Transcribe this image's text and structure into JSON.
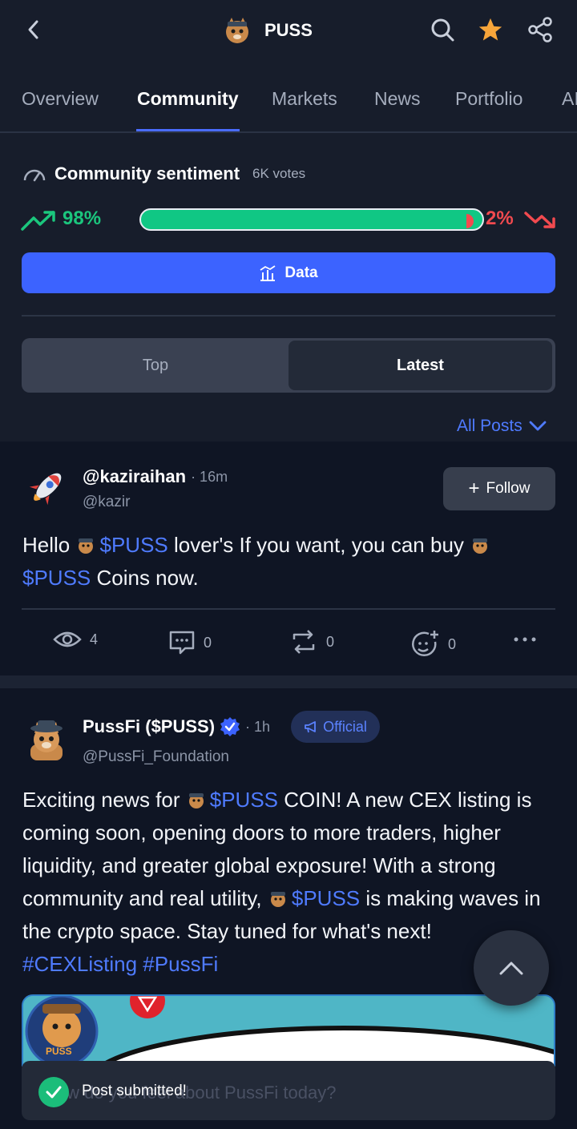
{
  "header": {
    "coin_name": "PUSS",
    "icons": [
      "back-chevron-icon",
      "search-icon",
      "star-icon",
      "share-icon"
    ],
    "star_color": "#f7a53a"
  },
  "tabs": [
    {
      "label": "Overview",
      "active": false
    },
    {
      "label": "Community",
      "active": true
    },
    {
      "label": "Markets",
      "active": false
    },
    {
      "label": "News",
      "active": false
    },
    {
      "label": "Portfolio",
      "active": false
    },
    {
      "label": "AI",
      "active": false
    }
  ],
  "sentiment": {
    "title": "Community sentiment",
    "votes": "6K votes",
    "bullish_pct": "98%",
    "bearish_pct": "2%",
    "bullish_fraction": 0.98,
    "bull_color": "#10c784",
    "bear_color": "#f24a4f",
    "data_button": "Data"
  },
  "filter": {
    "options": [
      "Top",
      "Latest"
    ],
    "selected": "Latest",
    "all_posts": "All Posts"
  },
  "posts": [
    {
      "author": "@kaziraihan",
      "time": "· 16m",
      "handle": "@kazir",
      "follow_label": "Follow",
      "text_parts": {
        "p1": "Hello ",
        "tag1": "$PUSS",
        "p2": " lover's If you want, you can buy ",
        "tag2": "$PUSS",
        "p3": "  Coins now."
      },
      "stats": {
        "views": "4",
        "comments": "0",
        "reposts": "0",
        "reactions": "0"
      }
    },
    {
      "author": "PussFi ($PUSS)",
      "time": "· 1h",
      "handle": "@PussFi_Foundation",
      "badge": "Official",
      "text_parts": {
        "p1": "Exciting news for ",
        "tag1": "$PUSS",
        "p2": " COIN!  A new CEX listing is coming soon, opening doors to more traders, higher liquidity, and greater global exposure! With a strong community and real utility, ",
        "tag2": "$PUSS",
        "p3": " is making waves in the crypto space. Stay tuned for what's next!  ",
        "tag3": "#CEXListing",
        "tag4": " #PussFi"
      },
      "image_logo_text": "PUSS"
    }
  ],
  "composer": {
    "placeholder": "How do you feel about PussFi today?"
  },
  "toast": {
    "text": "Post submitted!"
  }
}
